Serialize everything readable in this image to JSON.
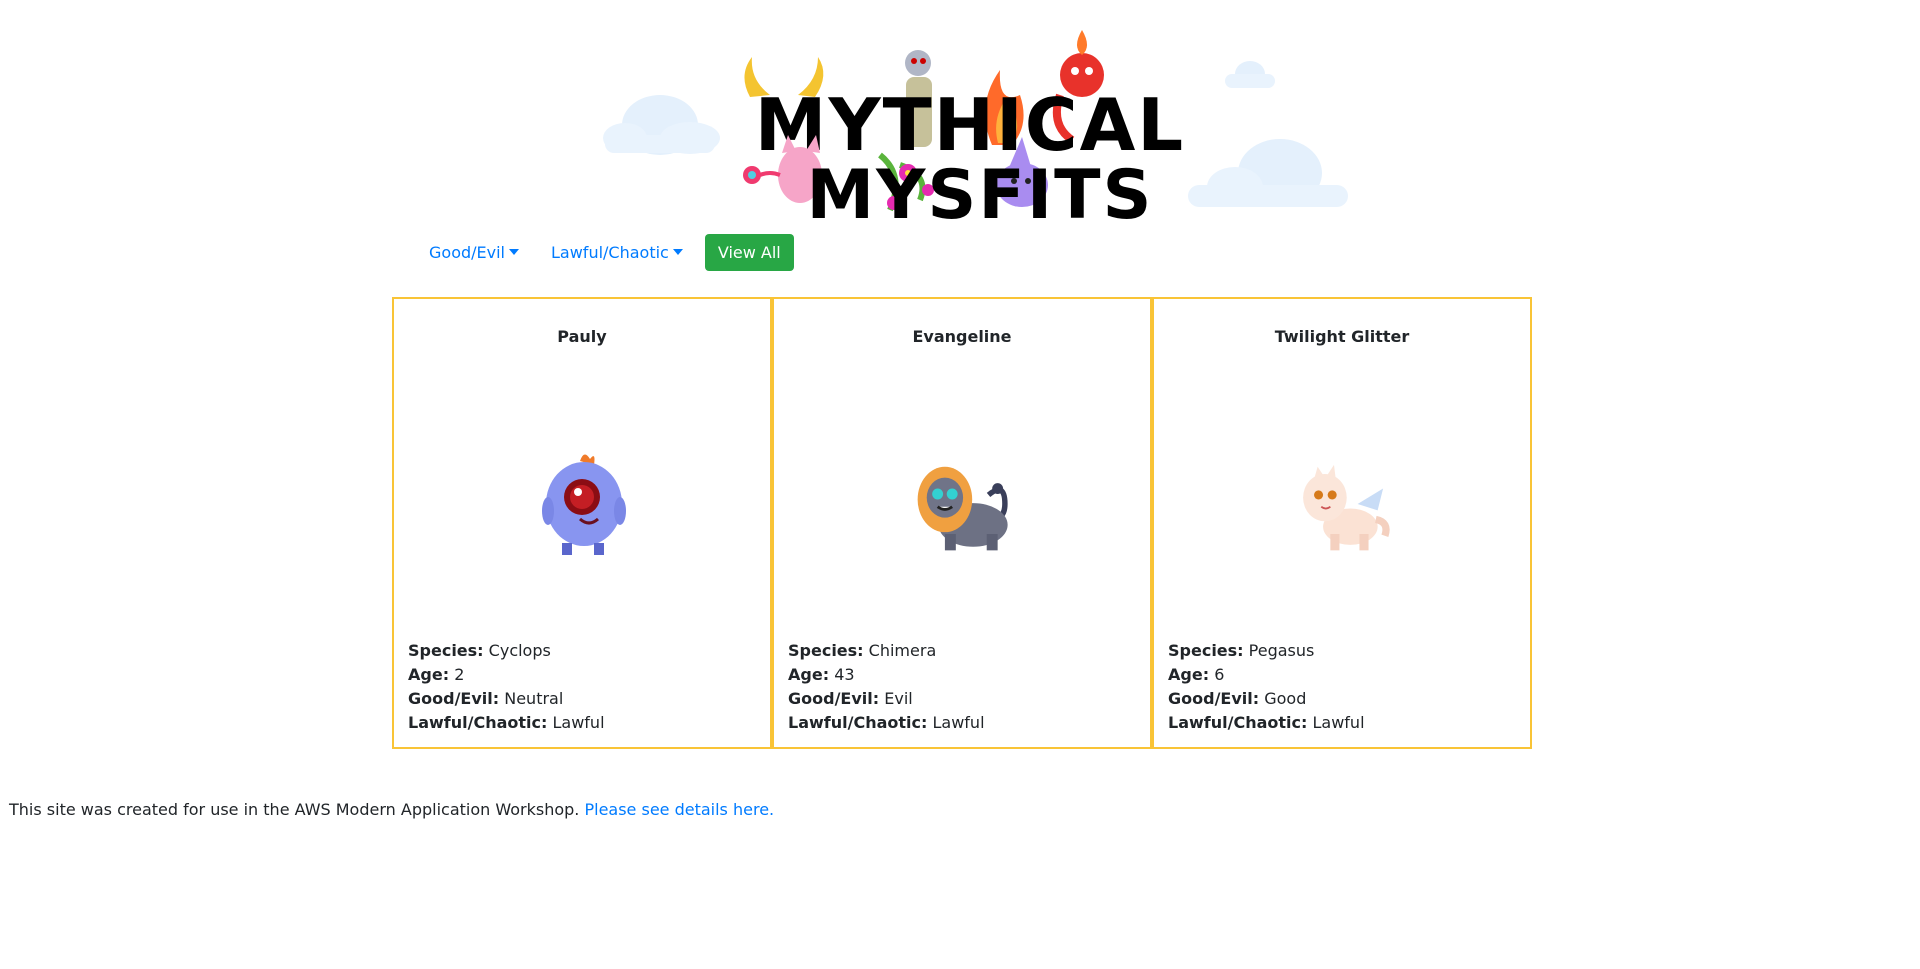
{
  "logo": {
    "line1": "MYTHICAL",
    "line2": "MYSFITS"
  },
  "nav": {
    "good_evil_label": "Good/Evil",
    "lawful_chaotic_label": "Lawful/Chaotic",
    "view_all_label": "View All"
  },
  "labels": {
    "species": "Species:",
    "age": "Age:",
    "good_evil": "Good/Evil:",
    "lawful_chaotic": "Lawful/Chaotic:"
  },
  "mysfits": [
    {
      "name": "Pauly",
      "species": "Cyclops",
      "age": "2",
      "good_evil": "Neutral",
      "lawful_chaotic": "Lawful"
    },
    {
      "name": "Evangeline",
      "species": "Chimera",
      "age": "43",
      "good_evil": "Evil",
      "lawful_chaotic": "Lawful"
    },
    {
      "name": "Twilight Glitter",
      "species": "Pegasus",
      "age": "6",
      "good_evil": "Good",
      "lawful_chaotic": "Lawful"
    }
  ],
  "footer": {
    "text": "This site was created for use in the AWS Modern Application Workshop.",
    "link_text": "Please see details here."
  },
  "colors": {
    "card_border": "#f9c436",
    "link": "#007bff",
    "button": "#28a745"
  }
}
